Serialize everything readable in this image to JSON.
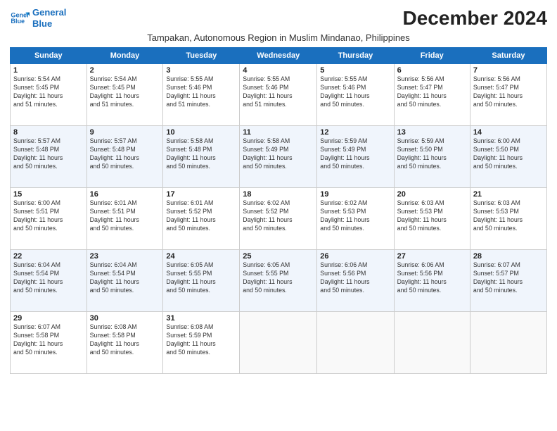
{
  "logo": {
    "line1": "General",
    "line2": "Blue"
  },
  "title": "December 2024",
  "subtitle": "Tampakan, Autonomous Region in Muslim Mindanao, Philippines",
  "days_of_week": [
    "Sunday",
    "Monday",
    "Tuesday",
    "Wednesday",
    "Thursday",
    "Friday",
    "Saturday"
  ],
  "weeks": [
    [
      {
        "day": "1",
        "lines": [
          "Sunrise: 5:54 AM",
          "Sunset: 5:45 PM",
          "Daylight: 11 hours",
          "and 51 minutes."
        ]
      },
      {
        "day": "2",
        "lines": [
          "Sunrise: 5:54 AM",
          "Sunset: 5:45 PM",
          "Daylight: 11 hours",
          "and 51 minutes."
        ]
      },
      {
        "day": "3",
        "lines": [
          "Sunrise: 5:55 AM",
          "Sunset: 5:46 PM",
          "Daylight: 11 hours",
          "and 51 minutes."
        ]
      },
      {
        "day": "4",
        "lines": [
          "Sunrise: 5:55 AM",
          "Sunset: 5:46 PM",
          "Daylight: 11 hours",
          "and 51 minutes."
        ]
      },
      {
        "day": "5",
        "lines": [
          "Sunrise: 5:55 AM",
          "Sunset: 5:46 PM",
          "Daylight: 11 hours",
          "and 50 minutes."
        ]
      },
      {
        "day": "6",
        "lines": [
          "Sunrise: 5:56 AM",
          "Sunset: 5:47 PM",
          "Daylight: 11 hours",
          "and 50 minutes."
        ]
      },
      {
        "day": "7",
        "lines": [
          "Sunrise: 5:56 AM",
          "Sunset: 5:47 PM",
          "Daylight: 11 hours",
          "and 50 minutes."
        ]
      }
    ],
    [
      {
        "day": "8",
        "lines": [
          "Sunrise: 5:57 AM",
          "Sunset: 5:48 PM",
          "Daylight: 11 hours",
          "and 50 minutes."
        ]
      },
      {
        "day": "9",
        "lines": [
          "Sunrise: 5:57 AM",
          "Sunset: 5:48 PM",
          "Daylight: 11 hours",
          "and 50 minutes."
        ]
      },
      {
        "day": "10",
        "lines": [
          "Sunrise: 5:58 AM",
          "Sunset: 5:48 PM",
          "Daylight: 11 hours",
          "and 50 minutes."
        ]
      },
      {
        "day": "11",
        "lines": [
          "Sunrise: 5:58 AM",
          "Sunset: 5:49 PM",
          "Daylight: 11 hours",
          "and 50 minutes."
        ]
      },
      {
        "day": "12",
        "lines": [
          "Sunrise: 5:59 AM",
          "Sunset: 5:49 PM",
          "Daylight: 11 hours",
          "and 50 minutes."
        ]
      },
      {
        "day": "13",
        "lines": [
          "Sunrise: 5:59 AM",
          "Sunset: 5:50 PM",
          "Daylight: 11 hours",
          "and 50 minutes."
        ]
      },
      {
        "day": "14",
        "lines": [
          "Sunrise: 6:00 AM",
          "Sunset: 5:50 PM",
          "Daylight: 11 hours",
          "and 50 minutes."
        ]
      }
    ],
    [
      {
        "day": "15",
        "lines": [
          "Sunrise: 6:00 AM",
          "Sunset: 5:51 PM",
          "Daylight: 11 hours",
          "and 50 minutes."
        ]
      },
      {
        "day": "16",
        "lines": [
          "Sunrise: 6:01 AM",
          "Sunset: 5:51 PM",
          "Daylight: 11 hours",
          "and 50 minutes."
        ]
      },
      {
        "day": "17",
        "lines": [
          "Sunrise: 6:01 AM",
          "Sunset: 5:52 PM",
          "Daylight: 11 hours",
          "and 50 minutes."
        ]
      },
      {
        "day": "18",
        "lines": [
          "Sunrise: 6:02 AM",
          "Sunset: 5:52 PM",
          "Daylight: 11 hours",
          "and 50 minutes."
        ]
      },
      {
        "day": "19",
        "lines": [
          "Sunrise: 6:02 AM",
          "Sunset: 5:53 PM",
          "Daylight: 11 hours",
          "and 50 minutes."
        ]
      },
      {
        "day": "20",
        "lines": [
          "Sunrise: 6:03 AM",
          "Sunset: 5:53 PM",
          "Daylight: 11 hours",
          "and 50 minutes."
        ]
      },
      {
        "day": "21",
        "lines": [
          "Sunrise: 6:03 AM",
          "Sunset: 5:53 PM",
          "Daylight: 11 hours",
          "and 50 minutes."
        ]
      }
    ],
    [
      {
        "day": "22",
        "lines": [
          "Sunrise: 6:04 AM",
          "Sunset: 5:54 PM",
          "Daylight: 11 hours",
          "and 50 minutes."
        ]
      },
      {
        "day": "23",
        "lines": [
          "Sunrise: 6:04 AM",
          "Sunset: 5:54 PM",
          "Daylight: 11 hours",
          "and 50 minutes."
        ]
      },
      {
        "day": "24",
        "lines": [
          "Sunrise: 6:05 AM",
          "Sunset: 5:55 PM",
          "Daylight: 11 hours",
          "and 50 minutes."
        ]
      },
      {
        "day": "25",
        "lines": [
          "Sunrise: 6:05 AM",
          "Sunset: 5:55 PM",
          "Daylight: 11 hours",
          "and 50 minutes."
        ]
      },
      {
        "day": "26",
        "lines": [
          "Sunrise: 6:06 AM",
          "Sunset: 5:56 PM",
          "Daylight: 11 hours",
          "and 50 minutes."
        ]
      },
      {
        "day": "27",
        "lines": [
          "Sunrise: 6:06 AM",
          "Sunset: 5:56 PM",
          "Daylight: 11 hours",
          "and 50 minutes."
        ]
      },
      {
        "day": "28",
        "lines": [
          "Sunrise: 6:07 AM",
          "Sunset: 5:57 PM",
          "Daylight: 11 hours",
          "and 50 minutes."
        ]
      }
    ],
    [
      {
        "day": "29",
        "lines": [
          "Sunrise: 6:07 AM",
          "Sunset: 5:58 PM",
          "Daylight: 11 hours",
          "and 50 minutes."
        ]
      },
      {
        "day": "30",
        "lines": [
          "Sunrise: 6:08 AM",
          "Sunset: 5:58 PM",
          "Daylight: 11 hours",
          "and 50 minutes."
        ]
      },
      {
        "day": "31",
        "lines": [
          "Sunrise: 6:08 AM",
          "Sunset: 5:59 PM",
          "Daylight: 11 hours",
          "and 50 minutes."
        ]
      },
      {
        "day": "",
        "lines": []
      },
      {
        "day": "",
        "lines": []
      },
      {
        "day": "",
        "lines": []
      },
      {
        "day": "",
        "lines": []
      }
    ]
  ]
}
